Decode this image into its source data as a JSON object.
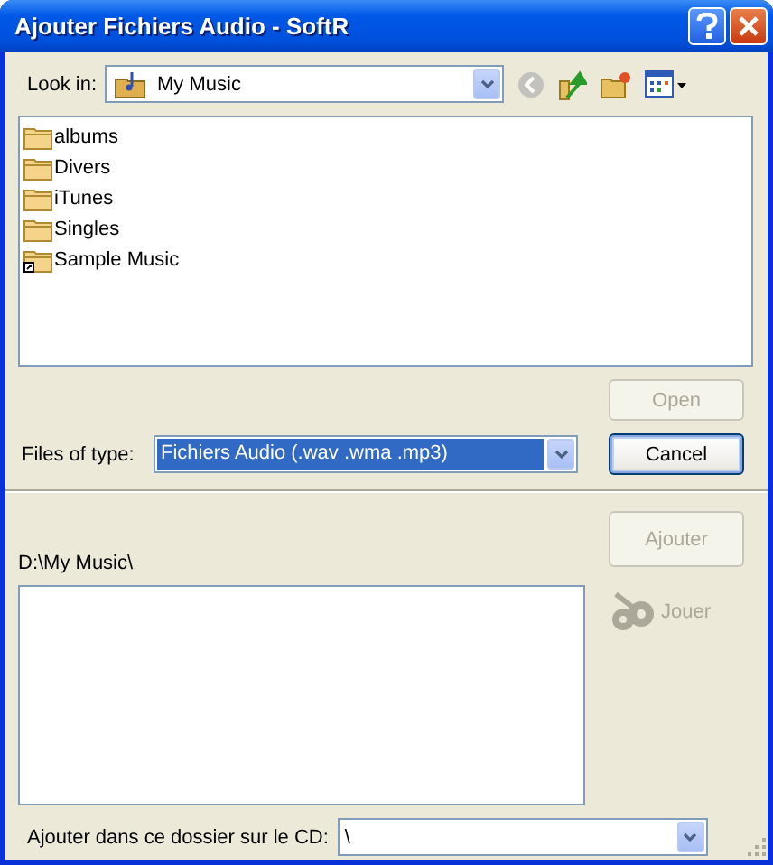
{
  "window": {
    "title": "Ajouter Fichiers Audio - SoftR"
  },
  "look_in": {
    "label": "Look in:",
    "value": "My Music"
  },
  "toolbar": [
    {
      "kind": "back",
      "disabled": true
    },
    {
      "kind": "up",
      "disabled": false
    },
    {
      "kind": "new-folder",
      "disabled": false
    },
    {
      "kind": "view-menu",
      "disabled": false
    }
  ],
  "files": [
    {
      "name": "albums",
      "kind": "folder"
    },
    {
      "name": "Divers",
      "kind": "folder"
    },
    {
      "name": "iTunes",
      "kind": "folder"
    },
    {
      "name": "Singles",
      "kind": "folder"
    },
    {
      "name": "Sample Music",
      "kind": "shortcut-folder"
    }
  ],
  "open_button": {
    "label": "Open",
    "disabled": true
  },
  "files_of_type": {
    "label": "Files of type:",
    "value": "Fichiers Audio (.wav .wma .mp3)",
    "focused": true
  },
  "cancel_button": {
    "label": "Cancel",
    "default": true
  },
  "ajouter_button": {
    "label": "Ajouter",
    "disabled": true
  },
  "path_label": "D:\\My Music\\",
  "jouer": {
    "label": "Jouer",
    "disabled": true
  },
  "cd_folder": {
    "label": "Ajouter dans ce dossier sur le CD:",
    "value": "\\"
  }
}
